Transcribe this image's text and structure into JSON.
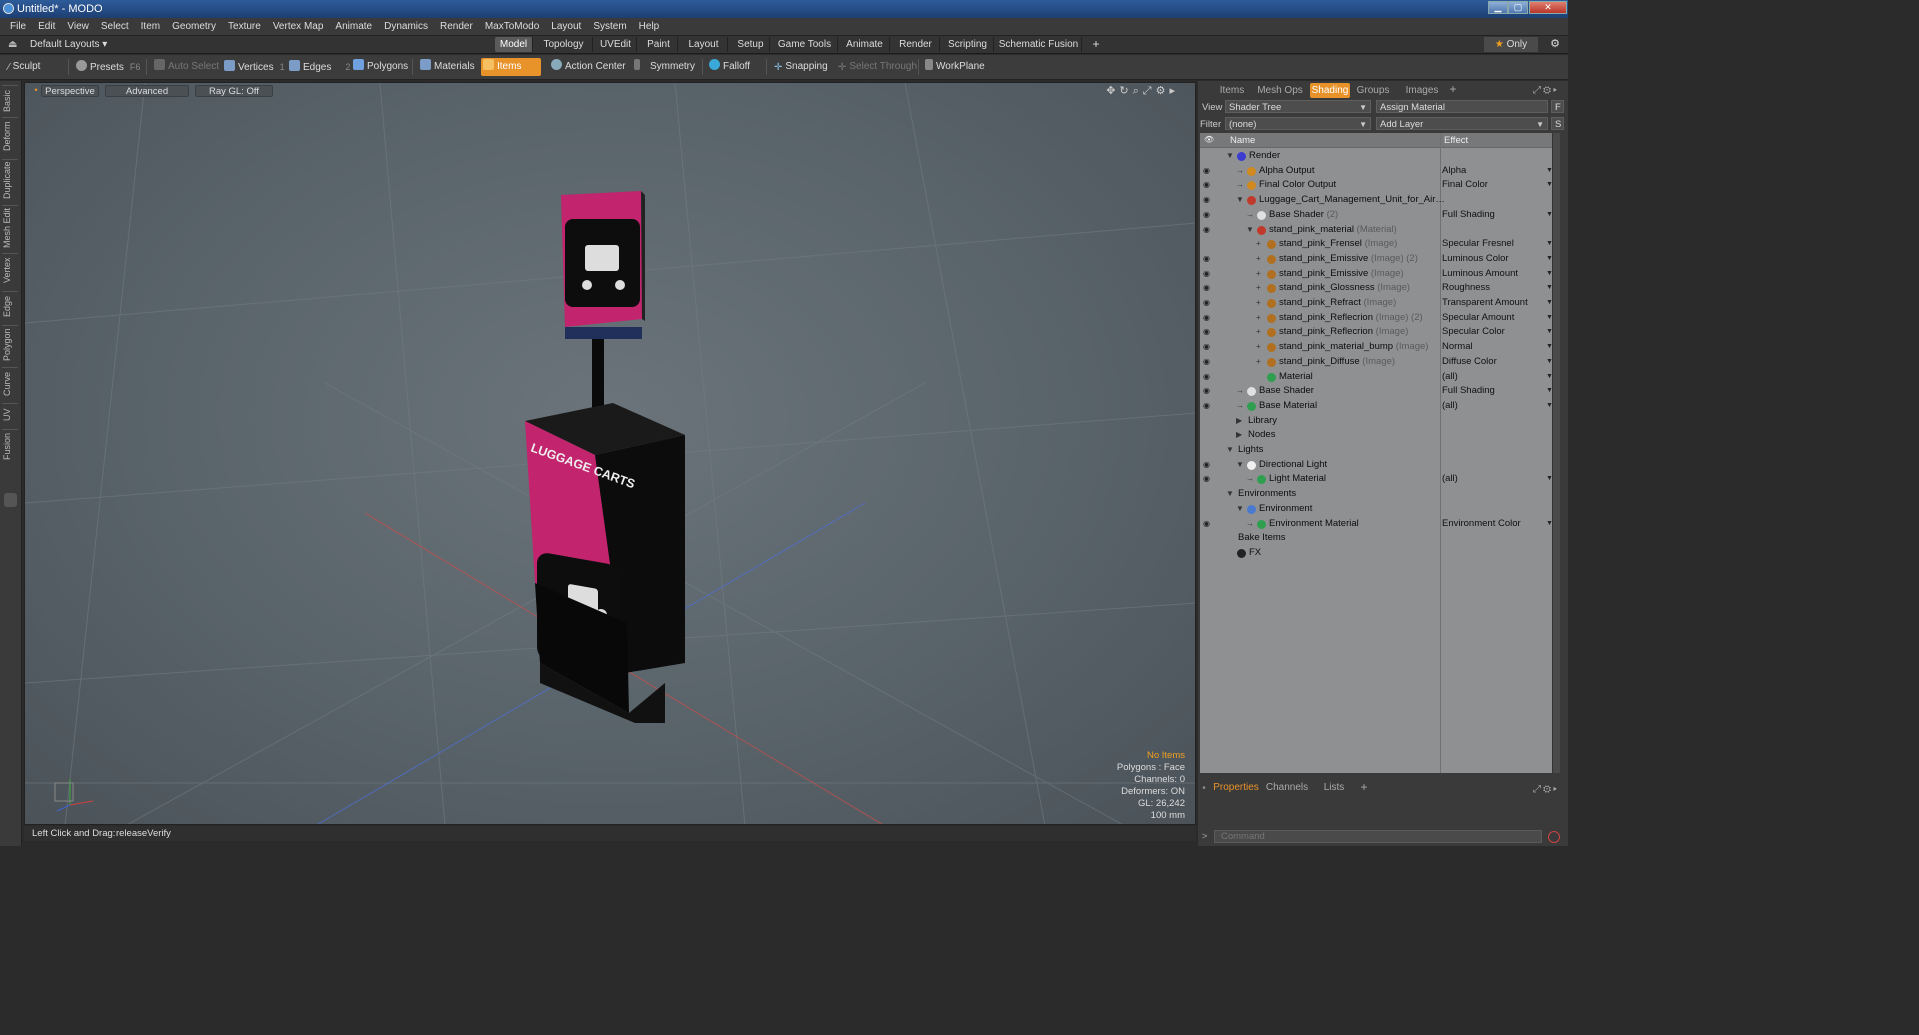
{
  "window": {
    "title": "Untitled* - MODO",
    "min": "▁",
    "max": "▢",
    "close": "✕"
  },
  "menu": [
    "File",
    "Edit",
    "View",
    "Select",
    "Item",
    "Geometry",
    "Texture",
    "Vertex Map",
    "Animate",
    "Dynamics",
    "Render",
    "MaxToModo",
    "Layout",
    "System",
    "Help"
  ],
  "layout_selector": "Default Layouts ▾",
  "layout_tabs": [
    "Model",
    "Topology",
    "UVEdit",
    "Paint",
    "Layout",
    "Setup",
    "Game Tools",
    "Animate",
    "Render",
    "Scripting",
    "Schematic Fusion"
  ],
  "add_tab": "+",
  "only_label": "Only",
  "toolbar": {
    "sculpt": "Sculpt",
    "presets": "Presets",
    "presets_key": "F6",
    "auto_select": "Auto Select",
    "vertices": "Vertices",
    "vertices_key": "1",
    "edges": "Edges",
    "edges_key": "2",
    "polygons": "Polygons",
    "materials": "Materials",
    "items": "Items",
    "action_center": "Action Center",
    "symmetry": "Symmetry",
    "falloff": "Falloff",
    "snapping": "Snapping",
    "select_through": "Select Through",
    "workplane": "WorkPlane"
  },
  "left_tabs": [
    "Basic",
    "Deform",
    "Duplicate",
    "Mesh Edit",
    "Vertex",
    "Edge",
    "Polygon",
    "Curve",
    "UV",
    "Fusion"
  ],
  "viewport": {
    "perspective": "Perspective",
    "advanced": "Advanced",
    "raygl": "Ray GL: Off",
    "sign_text": "LUGGAGE CARTS",
    "info": [
      "No Items",
      "Polygons : Face",
      "Channels: 0",
      "Deformers: ON",
      "GL: 26,242",
      "100 mm"
    ]
  },
  "status": {
    "label": "Left Click and Drag:",
    "value": "releaseVerify"
  },
  "right_tabs": [
    "Items",
    "Mesh Ops",
    "Shading",
    "Groups",
    "Images"
  ],
  "view_label": "View",
  "view_value": "Shader Tree",
  "assign_material": "Assign Material",
  "filter_label": "Filter",
  "filter_value": "(none)",
  "add_layer": "Add Layer",
  "btn_f": "F",
  "btn_s": "S",
  "tree_header": {
    "name": "Name",
    "effect": "Effect"
  },
  "tree": [
    {
      "eye": false,
      "exp": "▼",
      "ind": 0,
      "icon": "#3b3bd0",
      "name": "Render",
      "type": "",
      "effect": ""
    },
    {
      "eye": true,
      "exp": "→",
      "ind": 1,
      "icon": "#d08a20",
      "name": "Alpha Output",
      "type": "",
      "effect": "Alpha"
    },
    {
      "eye": true,
      "exp": "→",
      "ind": 1,
      "icon": "#d08a20",
      "name": "Final Color Output",
      "type": "",
      "effect": "Final Color"
    },
    {
      "eye": true,
      "exp": "▼",
      "ind": 1,
      "icon": "#c0392b",
      "name": "Luggage_Cart_Management_Unit_for_Air…",
      "type": "",
      "effect": ""
    },
    {
      "eye": true,
      "exp": "→",
      "ind": 2,
      "icon": "#e0e0e0",
      "name": "Base Shader",
      "type": "(2)",
      "effect": "Full Shading"
    },
    {
      "eye": true,
      "exp": "▼",
      "ind": 2,
      "icon": "#c0392b",
      "name": "stand_pink_material",
      "type": "(Material)",
      "effect": ""
    },
    {
      "eye": false,
      "exp": "+",
      "ind": 3,
      "icon": "#b07020",
      "name": "stand_pink_Frensel",
      "type": "(Image)",
      "effect": "Specular Fresnel"
    },
    {
      "eye": true,
      "exp": "+",
      "ind": 3,
      "icon": "#b07020",
      "name": "stand_pink_Emissive",
      "type": "(Image) (2)",
      "effect": "Luminous Color"
    },
    {
      "eye": true,
      "exp": "+",
      "ind": 3,
      "icon": "#b07020",
      "name": "stand_pink_Emissive",
      "type": "(Image)",
      "effect": "Luminous Amount"
    },
    {
      "eye": true,
      "exp": "+",
      "ind": 3,
      "icon": "#b07020",
      "name": "stand_pink_Glossness",
      "type": "(Image)",
      "effect": "Roughness"
    },
    {
      "eye": true,
      "exp": "+",
      "ind": 3,
      "icon": "#b07020",
      "name": "stand_pink_Refract",
      "type": "(Image)",
      "effect": "Transparent Amount"
    },
    {
      "eye": true,
      "exp": "+",
      "ind": 3,
      "icon": "#b07020",
      "name": "stand_pink_Reflecrion",
      "type": "(Image) (2)",
      "effect": "Specular Amount"
    },
    {
      "eye": true,
      "exp": "+",
      "ind": 3,
      "icon": "#b07020",
      "name": "stand_pink_Reflecrion",
      "type": "(Image)",
      "effect": "Specular Color"
    },
    {
      "eye": true,
      "exp": "+",
      "ind": 3,
      "icon": "#b07020",
      "name": "stand_pink_material_bump",
      "type": "(Image)",
      "effect": "Normal"
    },
    {
      "eye": true,
      "exp": "+",
      "ind": 3,
      "icon": "#b07020",
      "name": "stand_pink_Diffuse",
      "type": "(Image)",
      "effect": "Diffuse Color"
    },
    {
      "eye": true,
      "exp": "",
      "ind": 3,
      "icon": "#2e9e4f",
      "name": "Material",
      "type": "",
      "effect": "(all)"
    },
    {
      "eye": true,
      "exp": "→",
      "ind": 1,
      "icon": "#e0e0e0",
      "name": "Base Shader",
      "type": "",
      "effect": "Full Shading"
    },
    {
      "eye": true,
      "exp": "→",
      "ind": 1,
      "icon": "#2e9e4f",
      "name": "Base Material",
      "type": "",
      "effect": "(all)"
    },
    {
      "eye": false,
      "exp": "▶",
      "ind": 1,
      "icon": "",
      "name": "Library",
      "type": "",
      "effect": ""
    },
    {
      "eye": false,
      "exp": "▶",
      "ind": 1,
      "icon": "",
      "name": "Nodes",
      "type": "",
      "effect": ""
    },
    {
      "eye": false,
      "exp": "▼",
      "ind": 0,
      "icon": "",
      "name": "Lights",
      "type": "",
      "effect": ""
    },
    {
      "eye": true,
      "exp": "▼",
      "ind": 1,
      "icon": "#f0f0f0",
      "name": "Directional Light",
      "type": "",
      "effect": ""
    },
    {
      "eye": true,
      "exp": "→",
      "ind": 2,
      "icon": "#2e9e4f",
      "name": "Light Material",
      "type": "",
      "effect": "(all)"
    },
    {
      "eye": false,
      "exp": "▼",
      "ind": 0,
      "icon": "",
      "name": "Environments",
      "type": "",
      "effect": ""
    },
    {
      "eye": false,
      "exp": "▼",
      "ind": 1,
      "icon": "#4a7ad0",
      "name": "Environment",
      "type": "",
      "effect": ""
    },
    {
      "eye": true,
      "exp": "→",
      "ind": 2,
      "icon": "#2e9e4f",
      "name": "Environment Material",
      "type": "",
      "effect": "Environment Color"
    },
    {
      "eye": false,
      "exp": "",
      "ind": 0,
      "icon": "",
      "name": "Bake Items",
      "type": "",
      "effect": ""
    },
    {
      "eye": false,
      "exp": "",
      "ind": 0,
      "icon": "#222",
      "name": "FX",
      "type": "",
      "effect": ""
    }
  ],
  "bottom_tabs": [
    "Properties",
    "Channels",
    "Lists"
  ],
  "command_placeholder": "Command"
}
